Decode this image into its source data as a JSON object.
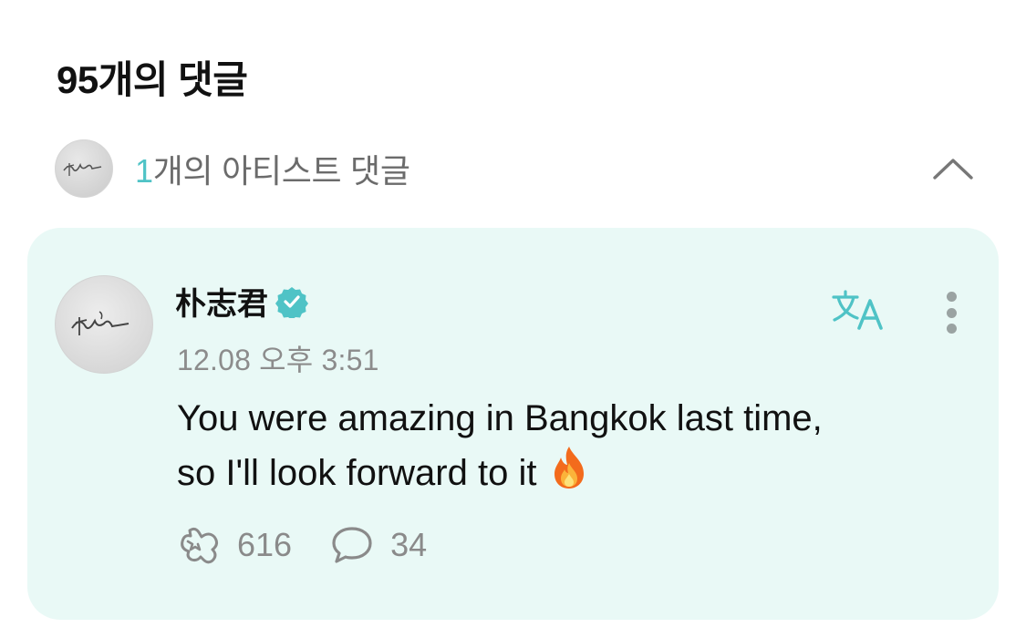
{
  "header": {
    "comments_title": "95개의 댓글"
  },
  "artist_comments": {
    "count_number": "1",
    "count_suffix": "개의 아티스트 댓글",
    "expanded": true
  },
  "comment": {
    "author": "朴志君",
    "verified": true,
    "timestamp": "12.08 오후 3:51",
    "body_line1": "You were amazing in Bangkok last time,",
    "body_line2": "so I'll look forward to it",
    "emoji": "fire",
    "likes": "616",
    "replies": "34"
  },
  "colors": {
    "accent": "#4fc3c6",
    "card_background": "#e9f9f6",
    "muted_text": "#8c8c8c"
  },
  "icons": [
    "chevron-up-icon",
    "verified-badge-icon",
    "translate-icon",
    "more-vertical-icon",
    "like-icon",
    "reply-icon",
    "fire-emoji-icon"
  ]
}
